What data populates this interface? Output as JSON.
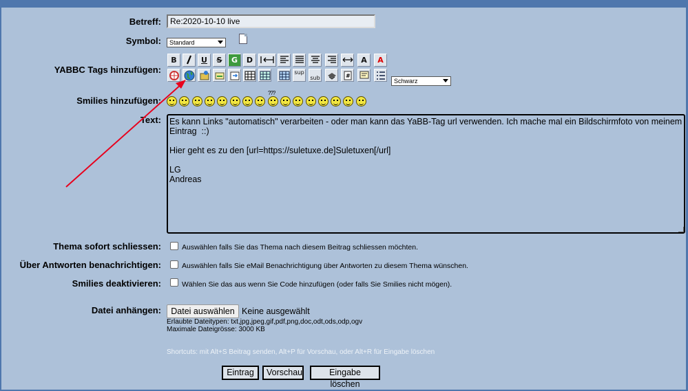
{
  "labels": {
    "subject": "Betreff:",
    "symbol": "Symbol:",
    "tags": "YABBC Tags hinzufügen:",
    "smilies": "Smilies hinzufügen:",
    "text": "Text:",
    "close_thread": "Thema sofort schliessen:",
    "notify": "Über Antworten benachrichtigen:",
    "disable_smilies": "Smilies deaktivieren:",
    "attach": "Datei anhängen:"
  },
  "subject_value": "Re:2020-10-10 live",
  "symbol_select": "Standard",
  "color_select": "Schwarz",
  "toolbar_row1": [
    "B",
    "I",
    "U",
    "S",
    "G",
    "D",
    "align-left",
    "align-justify",
    "align-left2",
    "center",
    "align-right",
    "hr",
    "font-size",
    "font-color"
  ],
  "toolbar_row2": [
    "flash",
    "url",
    "image",
    "email",
    "move",
    "table",
    "table2",
    "table3",
    "sup",
    "sub",
    "print",
    "code",
    "quote",
    "list"
  ],
  "toolbar_text": {
    "bold": "B",
    "italic": "I",
    "underline": "U",
    "strike": "S",
    "glow": "G",
    "shadow": "D",
    "sup": "sup",
    "sub": "sub",
    "font_size": "A",
    "font_color": "A"
  },
  "smilies_extra": "???",
  "message_text": "Es kann Links \"automatisch\" verarbeiten - oder man kann das YaBB-Tag url verwenden. Ich mache mal ein Bildschirmfoto von meinem Eintrag  ::)\n\nHier geht es zu den [url=https://suletuxe.de]Suletuxen[/url]\n\nLG\nAndreas",
  "checkboxes": {
    "close_thread": "Auswählen falls Sie das Thema nach diesem Beitrag schliessen möchten.",
    "notify": "Auswählen falls Sie eMail Benachrichtigung über Antworten zu diesem Thema wünschen.",
    "disable_smilies": "Wählen Sie das aus wenn Sie Code hinzufügen (oder falls Sie Smilies nicht mögen)."
  },
  "file": {
    "button": "Datei auswählen",
    "status": "Keine ausgewählt",
    "allowed": "Erlaubte Dateitypen: txt,jpg,jpeg,gif,pdf,png,doc,odt,ods,odp,ogv",
    "max": "Maximale Dateigrösse: 3000 KB"
  },
  "shortcuts": "Shortcuts: mit Alt+S Beitrag senden, Alt+P für Vorschau, oder Alt+R für Eingabe löschen",
  "buttons": {
    "submit": "Eintrag",
    "preview": "Vorschau",
    "clear": "Eingabe löschen"
  },
  "colors": {
    "background": "#adc1d9",
    "border": "#4f77ad",
    "arrow": "#e8001c"
  }
}
